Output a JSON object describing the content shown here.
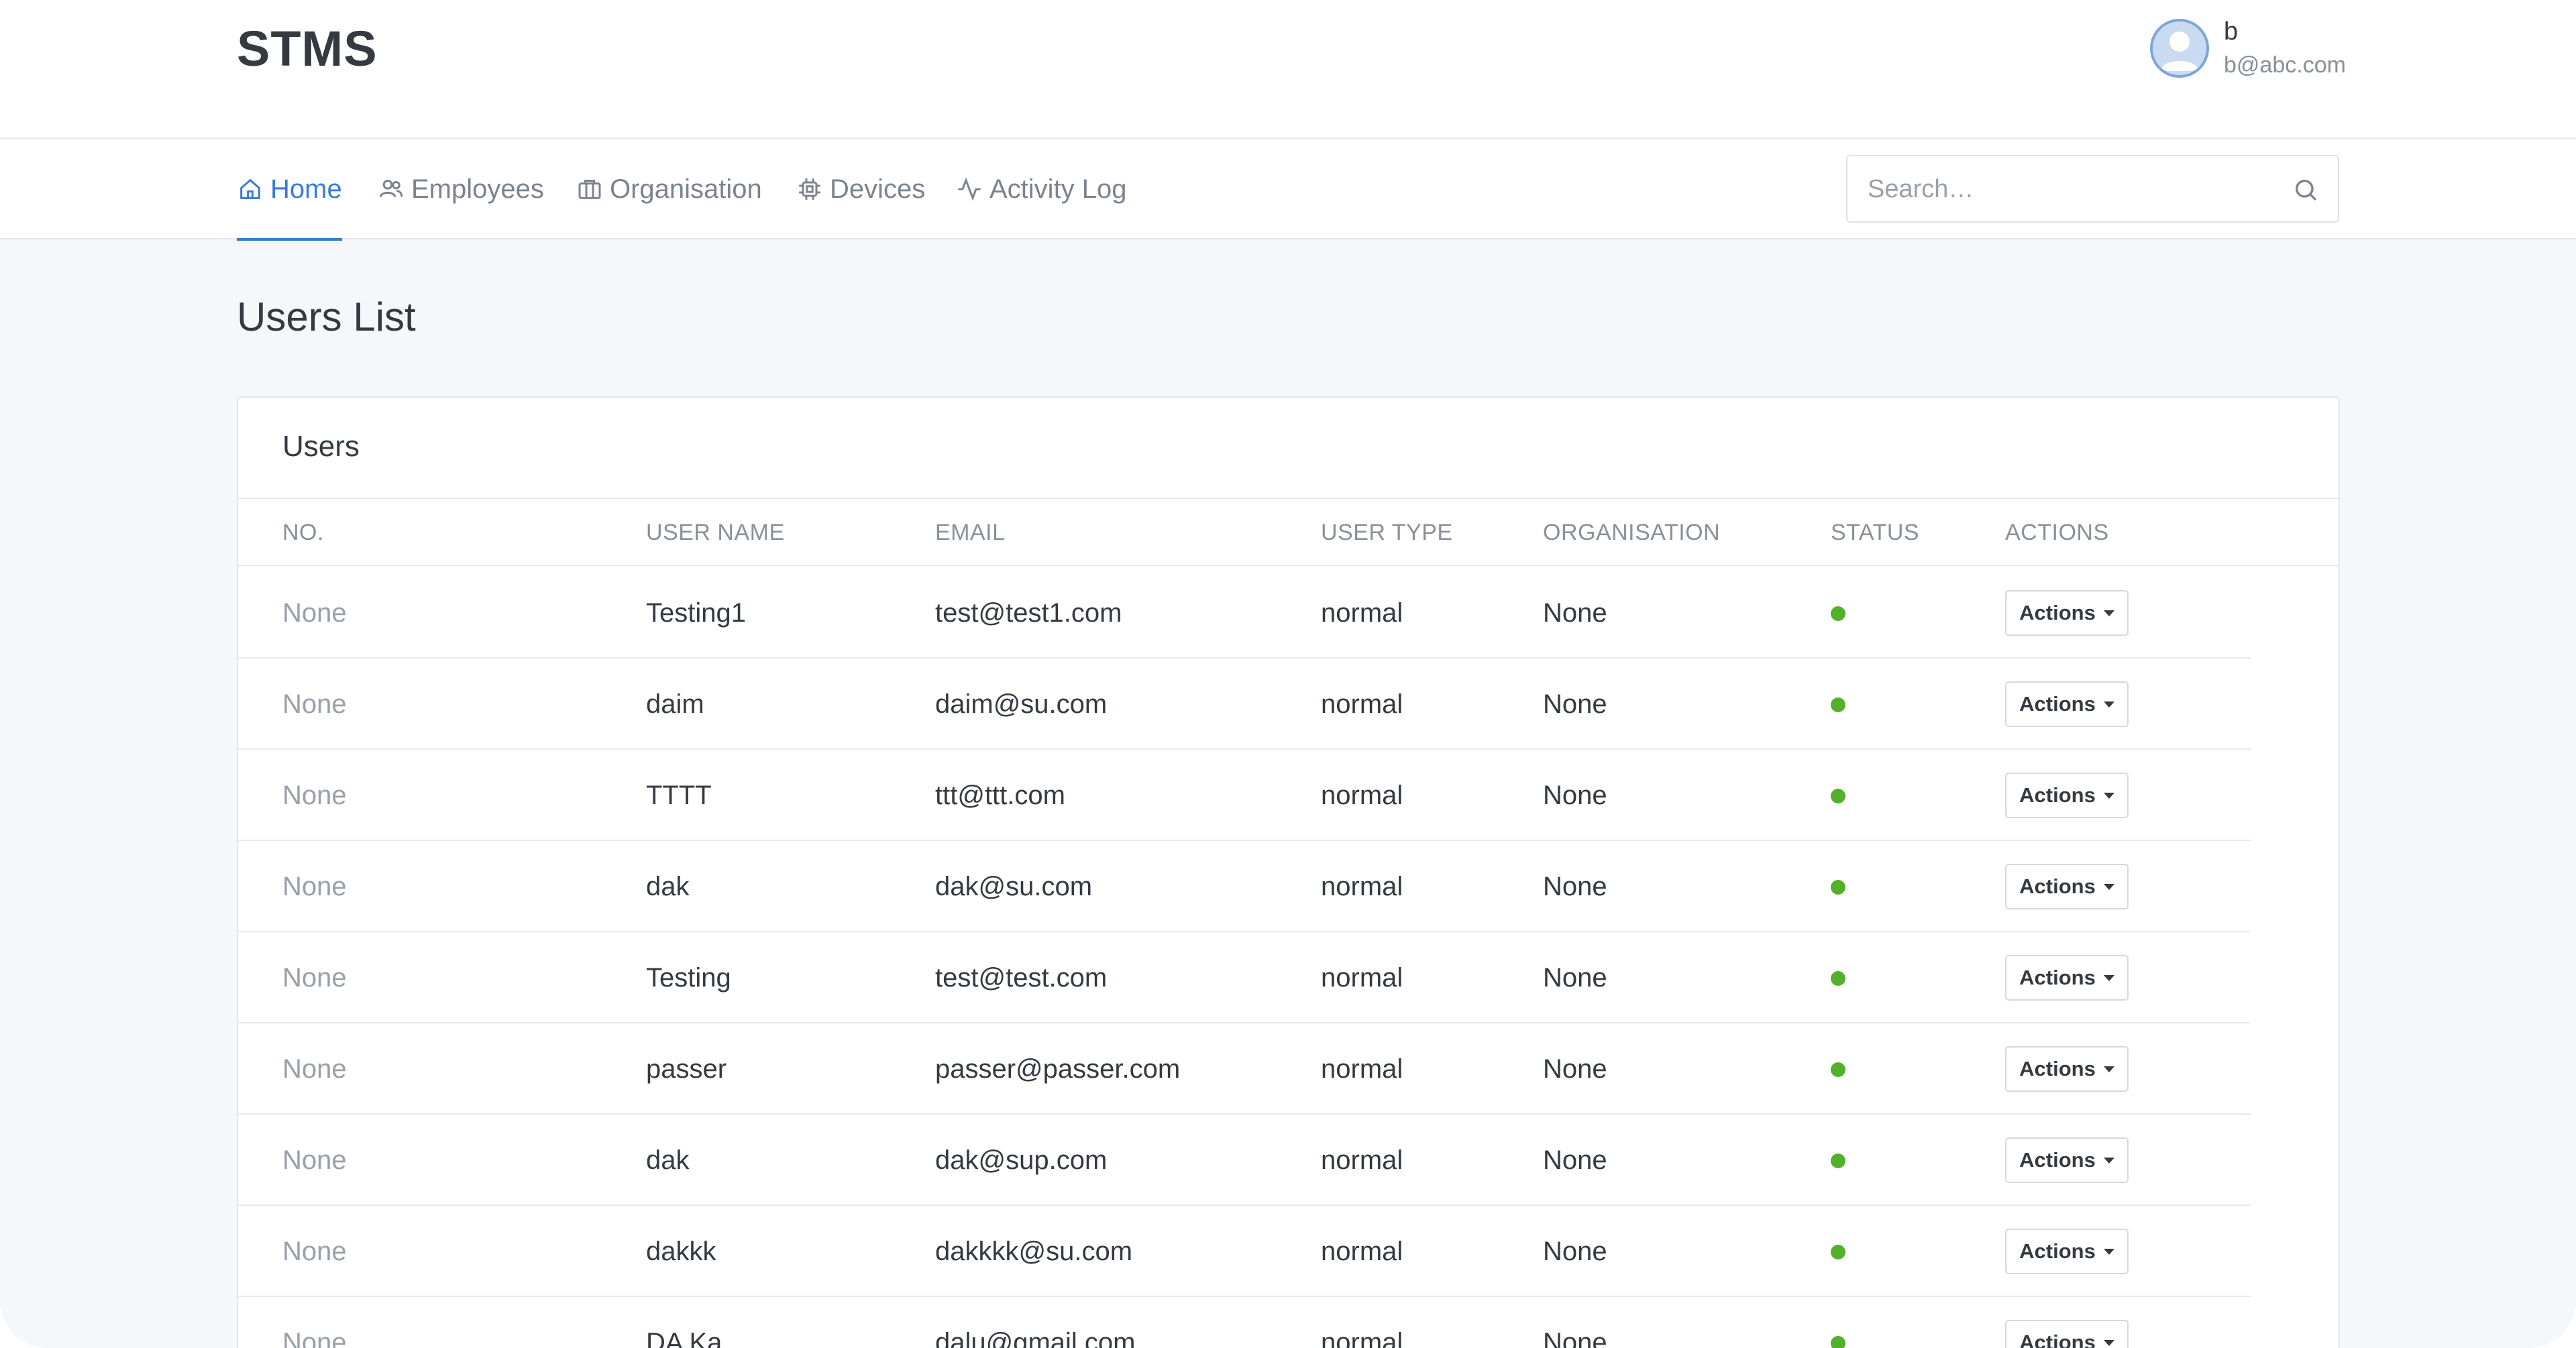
{
  "header": {
    "brand": "STMS",
    "user": {
      "name": "b",
      "email": "b@abc.com"
    }
  },
  "nav": {
    "items": [
      {
        "label": "Home",
        "icon": "home-icon",
        "active": true
      },
      {
        "label": "Employees",
        "icon": "users-icon",
        "active": false
      },
      {
        "label": "Organisation",
        "icon": "briefcase-icon",
        "active": false
      },
      {
        "label": "Devices",
        "icon": "chip-icon",
        "active": false
      },
      {
        "label": "Activity Log",
        "icon": "activity-icon",
        "active": false
      }
    ],
    "search": {
      "placeholder": "Search…",
      "value": ""
    }
  },
  "page": {
    "title": "Users List"
  },
  "card": {
    "title": "Users"
  },
  "table": {
    "columns": [
      "NO.",
      "USER NAME",
      "EMAIL",
      "USER TYPE",
      "ORGANISATION",
      "STATUS",
      "ACTIONS"
    ],
    "status_color": "#53b02a",
    "action_label": "Actions",
    "rows": [
      {
        "no": "None",
        "username": "Testing1",
        "email": "test@test1.com",
        "type": "normal",
        "org": "None",
        "status": "active"
      },
      {
        "no": "None",
        "username": "daim",
        "email": "daim@su.com",
        "type": "normal",
        "org": "None",
        "status": "active"
      },
      {
        "no": "None",
        "username": "TTTT",
        "email": "ttt@ttt.com",
        "type": "normal",
        "org": "None",
        "status": "active"
      },
      {
        "no": "None",
        "username": "dak",
        "email": "dak@su.com",
        "type": "normal",
        "org": "None",
        "status": "active"
      },
      {
        "no": "None",
        "username": "Testing",
        "email": "test@test.com",
        "type": "normal",
        "org": "None",
        "status": "active"
      },
      {
        "no": "None",
        "username": "passer",
        "email": "passer@passer.com",
        "type": "normal",
        "org": "None",
        "status": "active"
      },
      {
        "no": "None",
        "username": "dak",
        "email": "dak@sup.com",
        "type": "normal",
        "org": "None",
        "status": "active"
      },
      {
        "no": "None",
        "username": "dakkk",
        "email": "dakkkk@su.com",
        "type": "normal",
        "org": "None",
        "status": "active"
      },
      {
        "no": "None",
        "username": "DA Ka",
        "email": "dalu@gmail.com",
        "type": "normal",
        "org": "None",
        "status": "active"
      }
    ]
  }
}
